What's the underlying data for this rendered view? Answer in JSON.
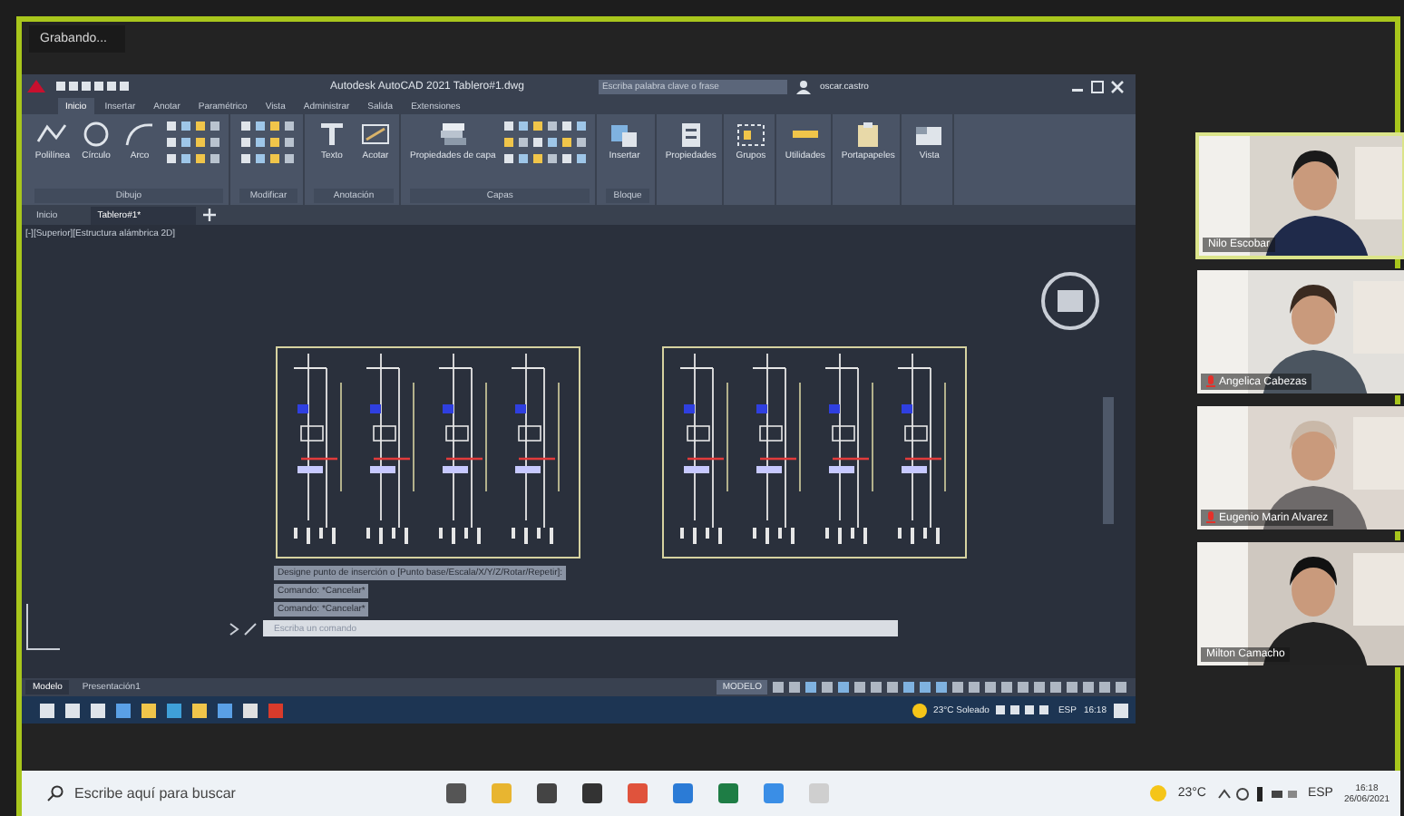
{
  "meeting": {
    "recording_label": "Grabando..."
  },
  "cad_window": {
    "title": "Autodesk AutoCAD 2021  Tablero#1.dwg",
    "search_placeholder": "Escriba palabra clave o frase",
    "user": "oscar.castro",
    "ribbon_tabs": [
      {
        "label": "Inicio",
        "selected": true
      },
      {
        "label": "Insertar",
        "selected": false
      },
      {
        "label": "Anotar",
        "selected": false
      },
      {
        "label": "Paramétrico",
        "selected": false
      },
      {
        "label": "Vista",
        "selected": false
      },
      {
        "label": "Administrar",
        "selected": false
      },
      {
        "label": "Salida",
        "selected": false
      },
      {
        "label": "Extensiones",
        "selected": false
      }
    ],
    "panels": [
      {
        "kind": "draw",
        "title": "Dibujo",
        "tools": [
          {
            "kind": "polyline",
            "label": "Polilínea"
          },
          {
            "kind": "circle",
            "label": "Círculo"
          },
          {
            "kind": "arc",
            "label": "Arco"
          }
        ]
      },
      {
        "kind": "modify",
        "title": "Modificar"
      },
      {
        "kind": "buttons",
        "title": "Anotación",
        "tools": [
          {
            "kind": "text",
            "label": "Texto"
          },
          {
            "kind": "dimension",
            "label": "Acotar"
          }
        ]
      },
      {
        "kind": "layers",
        "title": "Capas",
        "tools": [
          {
            "kind": "layers",
            "label": "Propiedades de capa"
          }
        ]
      },
      {
        "kind": "buttons",
        "title": "Bloque",
        "tools": [
          {
            "kind": "insert",
            "label": "Insertar"
          }
        ]
      },
      {
        "kind": "buttons",
        "tools": [
          {
            "kind": "properties",
            "label": "Propiedades"
          }
        ]
      },
      {
        "kind": "buttons",
        "tools": [
          {
            "kind": "group",
            "label": "Grupos"
          }
        ]
      },
      {
        "kind": "buttons",
        "tools": [
          {
            "kind": "utility",
            "label": "Utilidades"
          }
        ]
      },
      {
        "kind": "buttons",
        "tools": [
          {
            "kind": "clipboard",
            "label": "Portapapeles"
          }
        ]
      },
      {
        "kind": "buttons",
        "tools": [
          {
            "kind": "view",
            "label": "Vista"
          }
        ]
      }
    ],
    "doc_tabs": [
      {
        "label": "Inicio",
        "selected": false
      },
      {
        "label": "Tablero#1*",
        "selected": true
      }
    ],
    "viewport_label": "[-][Superior][Estructura alámbrica 2D]",
    "command_history": [
      "Designe punto de inserción o [Punto base/Escala/X/Y/Z/Rotar/Repetir]:",
      "Comando: *Cancelar*",
      "Comando: *Cancelar*"
    ],
    "command_placeholder": "Escriba un comando",
    "layout_tabs": [
      {
        "label": "Modelo",
        "selected": true
      },
      {
        "label": "Presentación1",
        "selected": false
      }
    ],
    "status_mode": "MODELO",
    "inner_taskbar": {
      "weather": "23°C  Soleado",
      "language": "ESP",
      "time": "16:18"
    }
  },
  "participants": [
    {
      "name": "Nilo Escobar",
      "active_speaker": true,
      "muted": false
    },
    {
      "name": "Angelica Cabezas",
      "active_speaker": false,
      "muted": true
    },
    {
      "name": "Eugenio Marin Alvarez",
      "active_speaker": false,
      "muted": true
    },
    {
      "name": "Milton Camacho",
      "active_speaker": false,
      "muted": false
    }
  ],
  "taskbar": {
    "search_placeholder": "Escribe aquí para buscar",
    "weather": "23°C",
    "language": "ESP",
    "time": "16:18",
    "date": "26/06/2021"
  }
}
